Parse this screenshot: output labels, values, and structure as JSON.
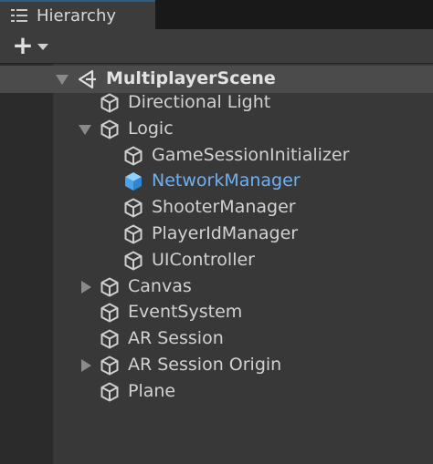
{
  "window": {
    "tab_title": "Hierarchy",
    "tab_icon": "list-icon"
  },
  "toolbar": {
    "add_label": "+",
    "dropdown_icon": "caret-down-icon"
  },
  "hierarchy": {
    "scene": {
      "label": "MultiplayerScene",
      "icon": "unity-logo-icon",
      "expanded": true
    },
    "items": [
      {
        "label": "Directional Light",
        "depth": 1,
        "expander": "none",
        "selected": false,
        "icon": "gameobject-cube-icon"
      },
      {
        "label": "Logic",
        "depth": 1,
        "expander": "expanded",
        "selected": false,
        "icon": "gameobject-cube-icon"
      },
      {
        "label": "GameSessionInitializer",
        "depth": 2,
        "expander": "none",
        "selected": false,
        "icon": "gameobject-cube-icon"
      },
      {
        "label": "NetworkManager",
        "depth": 2,
        "expander": "none",
        "selected": true,
        "icon": "gameobject-cube-filled-icon"
      },
      {
        "label": "ShooterManager",
        "depth": 2,
        "expander": "none",
        "selected": false,
        "icon": "gameobject-cube-icon"
      },
      {
        "label": "PlayerIdManager",
        "depth": 2,
        "expander": "none",
        "selected": false,
        "icon": "gameobject-cube-icon"
      },
      {
        "label": "UIController",
        "depth": 2,
        "expander": "none",
        "selected": false,
        "icon": "gameobject-cube-icon"
      },
      {
        "label": "Canvas",
        "depth": 1,
        "expander": "collapsed",
        "selected": false,
        "icon": "gameobject-cube-icon"
      },
      {
        "label": "EventSystem",
        "depth": 1,
        "expander": "none",
        "selected": false,
        "icon": "gameobject-cube-icon"
      },
      {
        "label": "AR Session",
        "depth": 1,
        "expander": "none",
        "selected": false,
        "icon": "gameobject-cube-icon"
      },
      {
        "label": "AR Session Origin",
        "depth": 1,
        "expander": "collapsed",
        "selected": false,
        "icon": "gameobject-cube-icon"
      },
      {
        "label": "Plane",
        "depth": 1,
        "expander": "none",
        "selected": false,
        "icon": "gameobject-cube-icon"
      }
    ]
  },
  "colors": {
    "selected_text": "#6fb1f0",
    "selected_icon": "#4aa3ea",
    "text": "#d2d2d2"
  }
}
